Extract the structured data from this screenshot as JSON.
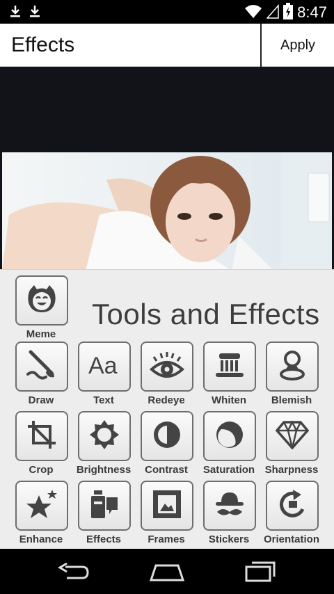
{
  "status_bar": {
    "time": "8:47",
    "left_icons": [
      "download-icon",
      "download-icon"
    ],
    "right_icons": [
      "wifi-icon",
      "signal-icon",
      "battery-charging-icon"
    ]
  },
  "header": {
    "title": "Effects",
    "apply_label": "Apply"
  },
  "panel": {
    "title": "Tools and Effects",
    "tools": [
      {
        "label": "Meme",
        "icon": "meme-face-icon"
      },
      {
        "label": "Draw",
        "icon": "brush-icon"
      },
      {
        "label": "Text",
        "icon": "text-aa-icon"
      },
      {
        "label": "Redeye",
        "icon": "eye-icon"
      },
      {
        "label": "Whiten",
        "icon": "toothbrush-icon"
      },
      {
        "label": "Blemish",
        "icon": "blemish-icon"
      },
      {
        "label": "Crop",
        "icon": "crop-icon"
      },
      {
        "label": "Brightness",
        "icon": "sun-icon"
      },
      {
        "label": "Contrast",
        "icon": "contrast-icon"
      },
      {
        "label": "Saturation",
        "icon": "saturation-icon"
      },
      {
        "label": "Sharpness",
        "icon": "diamond-icon"
      },
      {
        "label": "Enhance",
        "icon": "stars-icon"
      },
      {
        "label": "Effects",
        "icon": "effects-icon"
      },
      {
        "label": "Frames",
        "icon": "frame-icon"
      },
      {
        "label": "Stickers",
        "icon": "hat-mustache-icon"
      },
      {
        "label": "Orientation",
        "icon": "rotate-icon"
      }
    ]
  },
  "nav_bar": {
    "buttons": [
      "back-icon",
      "home-icon",
      "recents-icon"
    ]
  }
}
